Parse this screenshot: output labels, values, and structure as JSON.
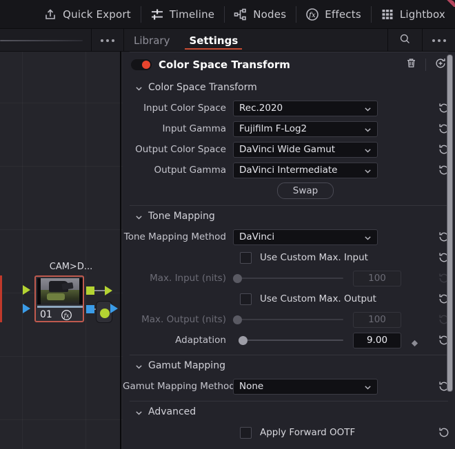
{
  "toolbar": {
    "items": [
      {
        "label": "Quick Export",
        "icon": "export-icon"
      },
      {
        "label": "Timeline",
        "icon": "timeline-icon"
      },
      {
        "label": "Nodes",
        "icon": "nodes-icon"
      },
      {
        "label": "Effects",
        "icon": "fx-icon"
      },
      {
        "label": "Lightbox",
        "icon": "lightbox-icon"
      }
    ]
  },
  "subtoolbar": {
    "tabs": [
      {
        "label": "Library",
        "active": false
      },
      {
        "label": "Settings",
        "active": true
      }
    ],
    "search_icon": "search-icon",
    "more_icon": "more-options-icon",
    "left_more_icon": "more-options-icon",
    "accent_color": "#c94b32"
  },
  "node_graph": {
    "node_label": "CAM>D...",
    "node_number": "01",
    "fx_icon": "fx-badge-icon",
    "selection_color": "#c05a4e",
    "green_port_color": "#b4d332",
    "blue_port_color": "#3b9ce8"
  },
  "inspector": {
    "enabled": true,
    "title": "Color Space Transform",
    "toggle_color": "#e8442e",
    "delete_icon": "trash-icon",
    "reset_all_icon": "add-keyframe-icon",
    "groups": [
      {
        "name": "Color Space Transform",
        "rows": [
          {
            "type": "select",
            "label": "Input Color Space",
            "value": "Rec.2020"
          },
          {
            "type": "select",
            "label": "Input Gamma",
            "value": "Fujifilm F-Log2"
          },
          {
            "type": "select",
            "label": "Output Color Space",
            "value": "DaVinci Wide Gamut"
          },
          {
            "type": "select",
            "label": "Output Gamma",
            "value": "DaVinci Intermediate"
          },
          {
            "type": "button",
            "label": "Swap"
          }
        ]
      },
      {
        "name": "Tone Mapping",
        "rows": [
          {
            "type": "select",
            "label": "Tone Mapping Method",
            "value": "DaVinci"
          },
          {
            "type": "checkbox",
            "label": "Use Custom Max. Input",
            "checked": false
          },
          {
            "type": "slider",
            "label": "Max. Input (nits)",
            "value": "100",
            "disabled": true,
            "knob_pct": 0
          },
          {
            "type": "checkbox",
            "label": "Use Custom Max. Output",
            "checked": false
          },
          {
            "type": "slider",
            "label": "Max. Output (nits)",
            "value": "100",
            "disabled": true,
            "knob_pct": 0
          },
          {
            "type": "slider",
            "label": "Adaptation",
            "value": "9.00",
            "disabled": false,
            "knob_pct": 8,
            "keyframe": true
          }
        ]
      },
      {
        "name": "Gamut Mapping",
        "rows": [
          {
            "type": "select",
            "label": "Gamut Mapping Method",
            "value": "None"
          }
        ]
      },
      {
        "name": "Advanced",
        "rows": [
          {
            "type": "checkbox",
            "label": "Apply Forward OOTF",
            "checked": false
          }
        ]
      }
    ]
  }
}
